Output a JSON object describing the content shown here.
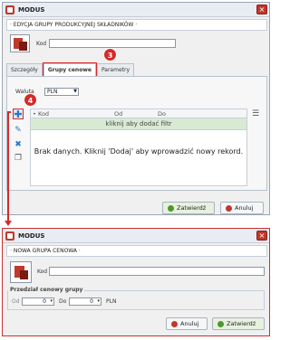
{
  "window1": {
    "title": "MODUS",
    "section": "EDYCJA GRUPY PRODUKCYJNEJ SKŁADNIKÓW",
    "kod_label": "Kod",
    "tabs": [
      "Szczegóły",
      "Grupy cenowe",
      "Parametry"
    ],
    "waluta_label": "Waluta",
    "waluta_value": "PLN",
    "grid_columns": [
      "Kod",
      "Od",
      "Do"
    ],
    "filter_text": "kliknij aby dodać filtr",
    "empty_message": "Brak danych. Kliknij 'Dodaj' aby wprowadzić nowy rekord.",
    "confirm_button": "Zatwierdź",
    "cancel_button": "Anuluj"
  },
  "window2": {
    "title": "MODUS",
    "section": "NOWA GRUPA CENOWA",
    "kod_label": "Kod",
    "range_label": "Przedział cenowy grupy",
    "od_label": "Od",
    "od_value": "0",
    "do_label": "Do",
    "do_value": "0",
    "currency": "PLN",
    "cancel_button": "Anuluj",
    "confirm_button": "Zatwierdź"
  },
  "annotations": {
    "step3": "3",
    "step4": "4"
  },
  "colors": {
    "accent_red": "#d62a2a",
    "brand": "#c0392b",
    "filter_row": "#d9ead3"
  }
}
